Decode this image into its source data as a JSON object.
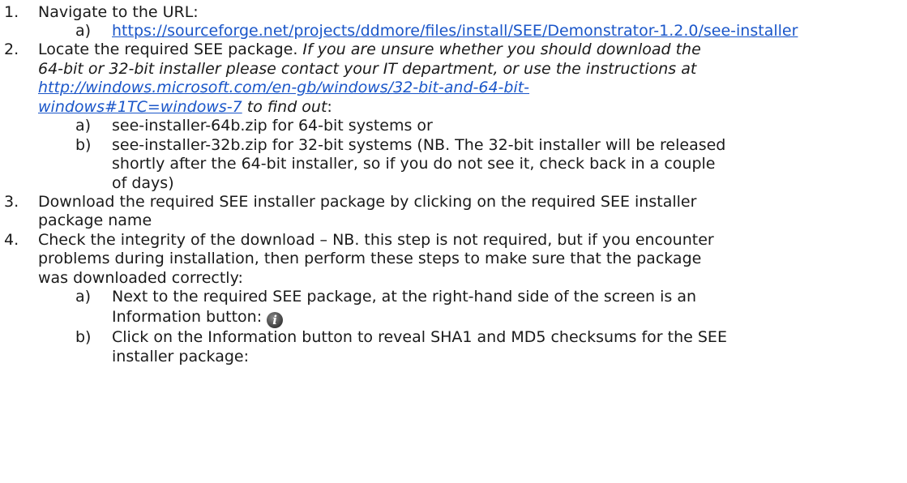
{
  "steps": {
    "s1": {
      "num": "1.",
      "text": "Navigate to the URL:",
      "a_label": "a)",
      "a_link": "https://sourceforge.net/projects/ddmore/files/install/SEE/Demonstrator-1.2.0/see-installer"
    },
    "s2": {
      "num": "2.",
      "text_a": "Locate the required SEE package. ",
      "italic_1": "If you are unsure whether you should download the",
      "italic_2": "64-bit or 32-bit installer please contact your IT department, or use the instructions at",
      "link_1": "http://windows.microsoft.com/en-gb/windows/32-bit-and-64-bit-",
      "link_2": "windows#1TC=windows-7",
      "italic_3": " to find out",
      "colon": ":",
      "a_label": "a)",
      "a_text": "see-installer-64b.zip for 64-bit systems or",
      "b_label": "b)",
      "b_1": "see-installer-32b.zip for 32-bit systems (NB. The 32-bit installer will be released",
      "b_2": "shortly after the 64-bit installer, so if you do not see it, check back in a couple",
      "b_3": "of days)"
    },
    "s3": {
      "num": "3.",
      "line_1": "Download the required SEE installer package by clicking on the required SEE installer",
      "line_2": "package name"
    },
    "s4": {
      "num": "4.",
      "line_1": "Check the integrity of the download – NB. this step is not required, but if you encounter",
      "line_2": "problems during installation, then perform these steps to make sure that the package",
      "line_3": "was downloaded correctly:",
      "a_label": "a)",
      "a_1": "Next to the required SEE package, at the right-hand side of the screen is an",
      "a_2": "Information button:",
      "info_icon": "info-icon",
      "b_label": "b)",
      "b_1": "Click on the Information button to reveal SHA1 and MD5 checksums for the SEE",
      "b_2": "installer package:"
    }
  }
}
